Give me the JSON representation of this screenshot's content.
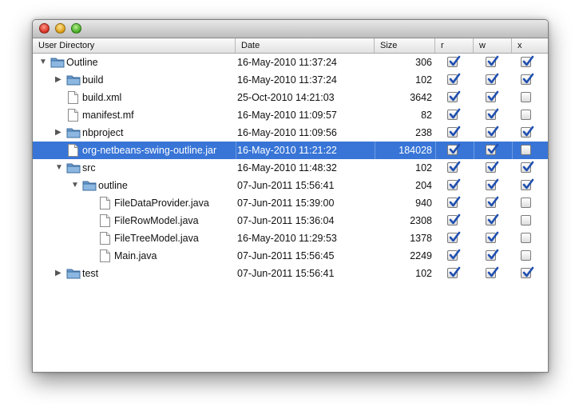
{
  "columns": {
    "user_directory": "User Directory",
    "date": "Date",
    "size": "Size",
    "r": "r",
    "w": "w",
    "x": "x"
  },
  "colors": {
    "selection": "#3875d7",
    "folder": "#6a9ccc",
    "check": "#1f4fb0"
  },
  "rows": [
    {
      "name": "Outline",
      "date": "16-May-2010 11:37:24",
      "size": "306",
      "r": true,
      "w": true,
      "x": true,
      "type": "folder",
      "depth": 0,
      "toggle": "expanded"
    },
    {
      "name": "build",
      "date": "16-May-2010 11:37:24",
      "size": "102",
      "r": true,
      "w": true,
      "x": true,
      "type": "folder",
      "depth": 1,
      "toggle": "collapsed"
    },
    {
      "name": "build.xml",
      "date": "25-Oct-2010 14:21:03",
      "size": "3642",
      "r": true,
      "w": true,
      "x": false,
      "type": "file",
      "depth": 1,
      "toggle": "none"
    },
    {
      "name": "manifest.mf",
      "date": "16-May-2010 11:09:57",
      "size": "82",
      "r": true,
      "w": true,
      "x": false,
      "type": "file",
      "depth": 1,
      "toggle": "none"
    },
    {
      "name": "nbproject",
      "date": "16-May-2010 11:09:56",
      "size": "238",
      "r": true,
      "w": true,
      "x": true,
      "type": "folder",
      "depth": 1,
      "toggle": "collapsed"
    },
    {
      "name": "org-netbeans-swing-outline.jar",
      "date": "16-May-2010 11:21:22",
      "size": "184028",
      "r": true,
      "w": true,
      "x": false,
      "type": "file",
      "depth": 1,
      "toggle": "none",
      "selected": true
    },
    {
      "name": "src",
      "date": "16-May-2010 11:48:32",
      "size": "102",
      "r": true,
      "w": true,
      "x": true,
      "type": "folder",
      "depth": 1,
      "toggle": "expanded"
    },
    {
      "name": "outline",
      "date": "07-Jun-2011 15:56:41",
      "size": "204",
      "r": true,
      "w": true,
      "x": true,
      "type": "folder",
      "depth": 2,
      "toggle": "expanded"
    },
    {
      "name": "FileDataProvider.java",
      "date": "07-Jun-2011 15:39:00",
      "size": "940",
      "r": true,
      "w": true,
      "x": false,
      "type": "file",
      "depth": 3,
      "toggle": "none"
    },
    {
      "name": "FileRowModel.java",
      "date": "07-Jun-2011 15:36:04",
      "size": "2308",
      "r": true,
      "w": true,
      "x": false,
      "type": "file",
      "depth": 3,
      "toggle": "none"
    },
    {
      "name": "FileTreeModel.java",
      "date": "16-May-2010 11:29:53",
      "size": "1378",
      "r": true,
      "w": true,
      "x": false,
      "type": "file",
      "depth": 3,
      "toggle": "none"
    },
    {
      "name": "Main.java",
      "date": "07-Jun-2011 15:56:45",
      "size": "2249",
      "r": true,
      "w": true,
      "x": false,
      "type": "file",
      "depth": 3,
      "toggle": "none"
    },
    {
      "name": "test",
      "date": "07-Jun-2011 15:56:41",
      "size": "102",
      "r": true,
      "w": true,
      "x": true,
      "type": "folder",
      "depth": 1,
      "toggle": "collapsed"
    }
  ]
}
